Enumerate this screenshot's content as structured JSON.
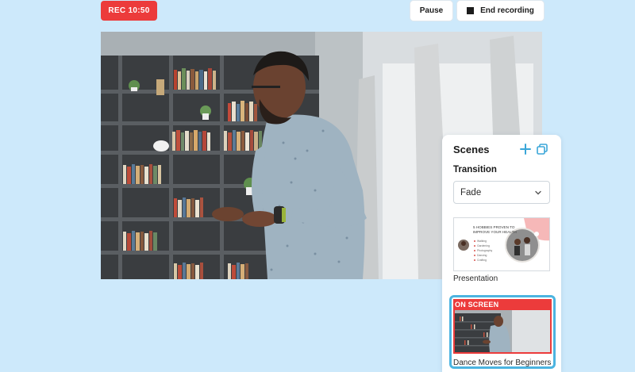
{
  "recording": {
    "status_label": "REC 10:50",
    "pause_label": "Pause",
    "end_label": "End recording"
  },
  "colors": {
    "background": "#cde9fb",
    "rec_red": "#ec3b3b",
    "accent_blue": "#4cb4e0"
  },
  "panel": {
    "title": "Scenes",
    "add_icon": "plus-icon",
    "duplicate_icon": "duplicate-icon",
    "transition_label": "Transition",
    "transition_value": "Fade",
    "scenes": [
      {
        "label": "Presentation",
        "slide_title_line1": "5 HOBBIES PROVEN TO",
        "slide_title_line2": "IMPROVE YOUR HEALTH",
        "bullets": [
          "Walking",
          "Gardening",
          "Photography",
          "Dancing",
          "Crafting"
        ],
        "active": false
      },
      {
        "label": "Dance Moves for Beginners",
        "badge": "ON SCREEN",
        "active": true
      }
    ]
  }
}
